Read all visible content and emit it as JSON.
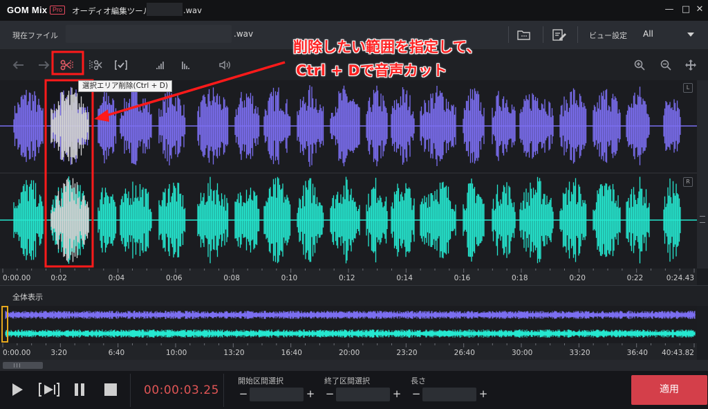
{
  "titlebar": {
    "logo": "GOM Mix",
    "logo_badge": "Pro",
    "app_title": "オーディオ編集ツール",
    "file_ext": ".wav",
    "min": "—",
    "max": "□",
    "close": "✕"
  },
  "filebar": {
    "label": "現在ファイル",
    "file_ext": ".wav",
    "view_label": "ビュー設定",
    "view_value": "All"
  },
  "toolbar": {
    "tooltip": "選択エリア削除(Ctrl + D)"
  },
  "channels": {
    "left": "L",
    "right": "R"
  },
  "ruler_top": [
    "0:00.00",
    "0:02",
    "0:04",
    "0:06",
    "0:08",
    "0:10",
    "0:12",
    "0:14",
    "0:16",
    "0:18",
    "0:20",
    "0:22",
    "0:24.43"
  ],
  "overview": {
    "label": "全体表示"
  },
  "ruler_bottom": [
    "0:00.00",
    "3:20",
    "6:40",
    "10:00",
    "13:20",
    "16:40",
    "20:00",
    "23:20",
    "26:40",
    "30:00",
    "33:20",
    "36:40",
    "40:43.82"
  ],
  "transport": {
    "timecode": "00:00:03.25",
    "start_label": "開始区間選択",
    "end_label": "終了区間選択",
    "length_label": "長さ",
    "minus": "−",
    "plus": "+",
    "apply": "適用"
  },
  "annotation": {
    "line1": "削除したい範囲を指定して、",
    "line2": "Ctrl + Dで音声カット"
  },
  "colors": {
    "wave_left": "#7b6ef0",
    "wave_right": "#25e8d0",
    "selected": "#d6d6d6",
    "highlight": "#ff1a1a",
    "apply": "#d43f4a"
  }
}
